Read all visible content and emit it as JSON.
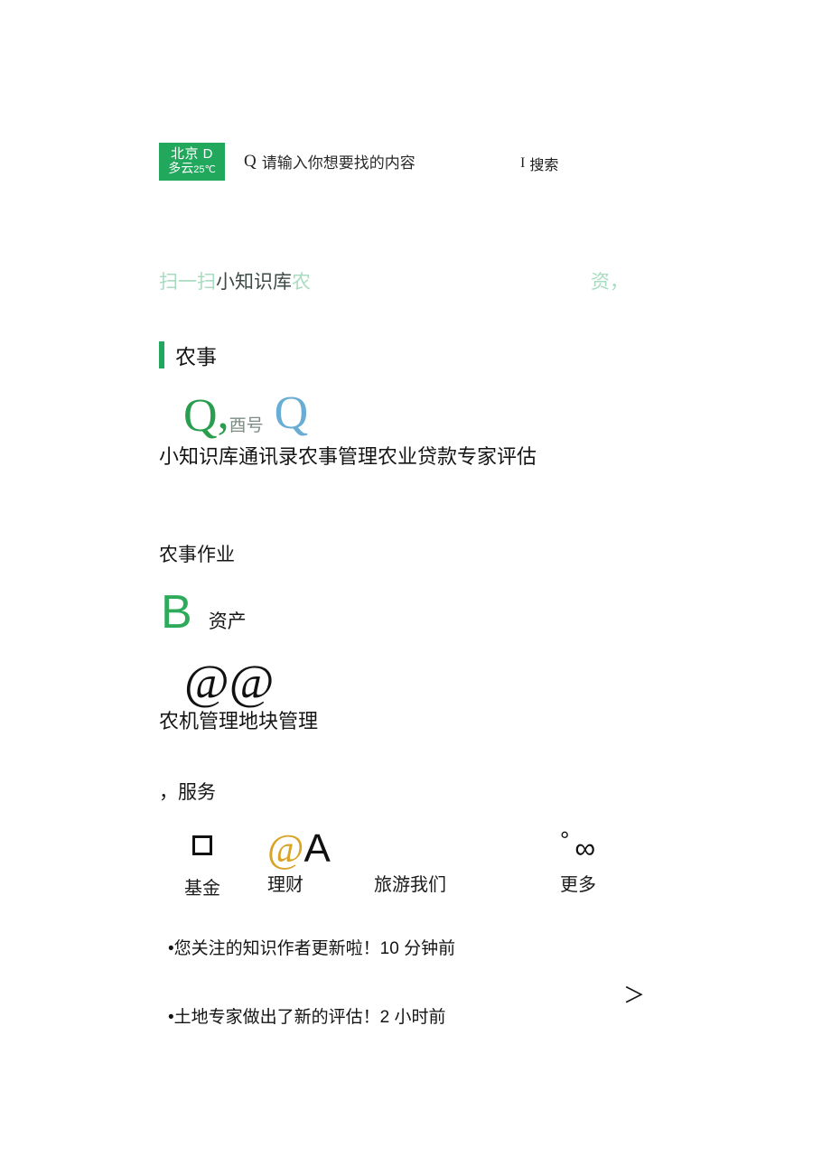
{
  "header": {
    "weather": {
      "city": "北京 D",
      "condition": "多云",
      "temperature": "25℃",
      "badge_color": "#22a85d"
    },
    "search": {
      "icon": "search-q-glyph",
      "placeholder": "请输入你想要找的内容",
      "value": "",
      "button_bar_glyph": "I",
      "button_label": "搜索"
    }
  },
  "quicklinks": {
    "scan_label": "扫一扫",
    "knowledge_label": "小知识库",
    "farm_label": "农",
    "right_label": "资，"
  },
  "sections": {
    "farming": {
      "title": "农事",
      "accent_color": "#22a85d",
      "icons": [
        {
          "glyph": "Q",
          "glyph_name": "q-green-icon",
          "color": "#2a9d4f",
          "label": "小知识库"
        },
        {
          "glyph": "酉号",
          "glyph_name": "contacts-text-icon",
          "color": "#7d8c84",
          "label": "通讯录"
        },
        {
          "glyph": "Q",
          "glyph_name": "q-blue-icon",
          "color": "#6aadd4",
          "label": "农事管理"
        },
        {
          "glyph": "",
          "glyph_name": "loan-icon",
          "color": "#111111",
          "label": "农业贷款"
        },
        {
          "glyph": "",
          "glyph_name": "expert-review-icon",
          "color": "#111111",
          "label": "专家评估"
        }
      ],
      "labels_joined": "小知识库通讯录农事管理农业贷款专家评估"
    },
    "farm_work": {
      "title": "农事作业",
      "icons": [
        {
          "glyph": "B",
          "glyph_name": "asset-b-icon",
          "color": "#2faa5a",
          "label": "资产"
        },
        {
          "glyph": "@",
          "glyph_name": "machinery-at-icon",
          "color": "#111111",
          "label": "农机管理"
        },
        {
          "glyph": "@",
          "glyph_name": "land-at-icon",
          "color": "#111111",
          "label": "地块管理"
        }
      ],
      "labels_joined": "农机管理地块管理"
    },
    "services": {
      "title": "，服务",
      "icons": [
        {
          "glyph": "□",
          "glyph_name": "fund-square-icon",
          "color": "#111111",
          "label": "基金"
        },
        {
          "glyph": "@",
          "glyph_name": "finance-at-icon",
          "color": "#d9a326",
          "label": "理财"
        },
        {
          "glyph": "A",
          "glyph_name": "travel-a-icon",
          "color": "#111111",
          "label": "旅游我们"
        },
        {
          "glyph": "°∞",
          "glyph_name": "more-infinity-icon",
          "color": "#111111",
          "label": "更多"
        }
      ]
    }
  },
  "notifications": {
    "items": [
      {
        "bullet": "•",
        "text": "您关注的知识作者更新啦！10 分钟前"
      },
      {
        "bullet": "•",
        "text": "土地专家做出了新的评估！2 小时前"
      }
    ],
    "chevron": "＞"
  }
}
